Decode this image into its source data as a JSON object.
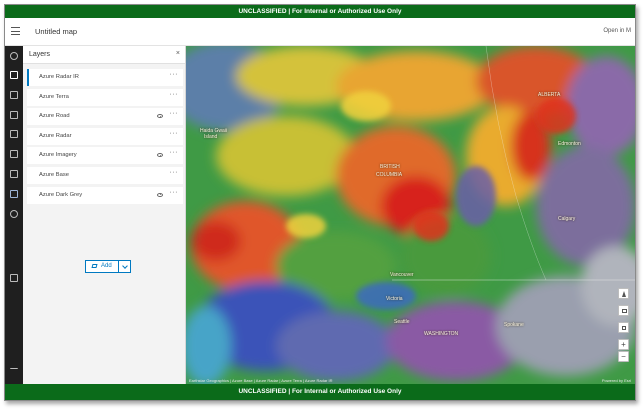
{
  "banner": {
    "top_text": "UNCLASSIFIED | For Internal or Authorized Use Only",
    "bottom_text": "UNCLASSIFIED | For Internal or Authorized Use Only",
    "color": "#0b6b1a"
  },
  "header": {
    "title": "Untitled map",
    "open_in": "Open in M"
  },
  "action_bar": {
    "icons": [
      "add-layer-icon",
      "layers-icon",
      "table-icon",
      "legend-icon",
      "bookmarks-icon",
      "sketch-icon",
      "basemap-icon",
      "filter-icon",
      "properties-icon",
      "settings-icon",
      "print-icon",
      "expand-icon"
    ]
  },
  "layers_panel": {
    "title": "Layers",
    "close": "×",
    "more": "···",
    "items": [
      {
        "label": "Azure Radar IR",
        "visible": false,
        "selected": true
      },
      {
        "label": "Azure Terra",
        "visible": false,
        "selected": false
      },
      {
        "label": "Azure Road",
        "visible": true,
        "selected": false
      },
      {
        "label": "Azure Radar",
        "visible": false,
        "selected": false
      },
      {
        "label": "Azure Imagery",
        "visible": true,
        "selected": false
      },
      {
        "label": "Azure Base",
        "visible": false,
        "selected": false
      },
      {
        "label": "Azure Dark Grey",
        "visible": true,
        "selected": false
      }
    ],
    "add_label": "Add"
  },
  "map": {
    "labels": {
      "alberta": "ALBERTA",
      "edmonton": "Edmonton",
      "british_columbia_1": "BRITISH",
      "british_columbia_2": "COLUMBIA",
      "calgary": "Calgary",
      "vancouver": "Vancouver",
      "victoria": "Victoria",
      "seattle": "Seattle",
      "washington": "WASHINGTON",
      "spokane": "Spokane",
      "haida_gwaii_1": "Haida Gwaii",
      "haida_gwaii_2": "Island"
    },
    "attribution": "Earthstar Geographics | Azure Base | Azure Radar | Azure Terra | Azure Radar IR",
    "powered_by": "Powered by Esri",
    "zoom_in": "+",
    "zoom_out": "−"
  }
}
